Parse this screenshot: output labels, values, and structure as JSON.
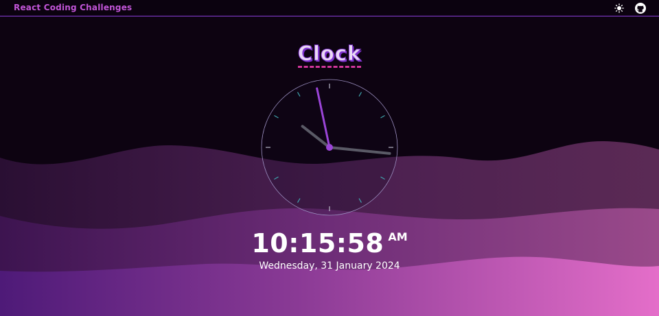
{
  "navbar": {
    "brand": "React Coding Challenges",
    "icons": [
      "sun-icon",
      "github-icon"
    ]
  },
  "clock_app": {
    "title": "Clock",
    "time": "10:15:58",
    "period": "AM",
    "date": "Wednesday, 31 January 2024",
    "hands": {
      "hours": 10,
      "minutes": 15,
      "seconds": 58
    }
  },
  "colors": {
    "background": "#0d0311",
    "accent": "#8a3fd8",
    "brand_text": "#c255d8",
    "second_hand": "#9b45d8",
    "hour_minute_hand": "#5a5a66",
    "tick": "#3fa6ae",
    "wave_pink": "#e06ac8"
  }
}
